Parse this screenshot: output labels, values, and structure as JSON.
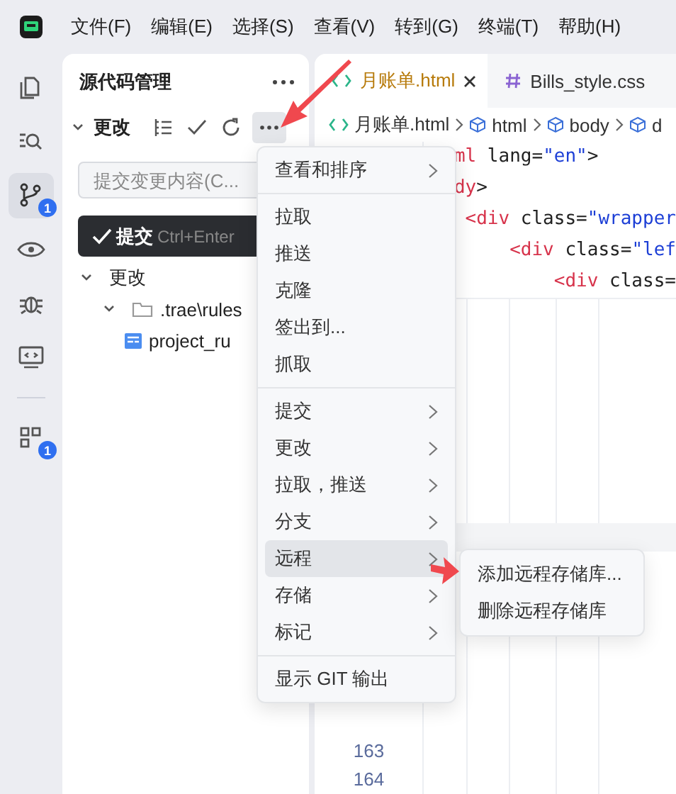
{
  "title_bar": {
    "menus": [
      "文件(F)",
      "编辑(E)",
      "选择(S)",
      "查看(V)",
      "转到(G)",
      "终端(T)",
      "帮助(H)"
    ]
  },
  "activity_bar": {
    "items": [
      {
        "kind": "files",
        "selected": false
      },
      {
        "kind": "search",
        "selected": false
      },
      {
        "kind": "git",
        "selected": true,
        "badge": "1"
      },
      {
        "kind": "eye",
        "selected": false
      },
      {
        "kind": "debug",
        "selected": false
      },
      {
        "kind": "remote",
        "selected": false
      },
      {
        "kind": "extensions",
        "selected": false,
        "badge": "1"
      }
    ]
  },
  "sidebar": {
    "title": "源代码管理",
    "section": {
      "label": "更改",
      "expanded": true
    },
    "commit_input": {
      "placeholder": "提交变更内容(C..."
    },
    "commit_button": {
      "label": "提交",
      "shortcut": "Ctrl+Enter"
    },
    "tree": [
      {
        "label": "更改",
        "expanded": true,
        "children": [
          {
            "label": ".trae\\rules",
            "kind": "folder",
            "expanded": true,
            "children": [
              {
                "label": "project_ru",
                "kind": "file"
              }
            ]
          }
        ]
      }
    ]
  },
  "editor": {
    "tabs": [
      {
        "label": "月账单.html",
        "kind": "html",
        "selected": true
      },
      {
        "label": "Bills_style.css",
        "kind": "css",
        "selected": false
      }
    ],
    "breadcrumb": [
      {
        "label": "月账单.html",
        "kind": "file"
      },
      {
        "label": "html",
        "kind": "element"
      },
      {
        "label": "body",
        "kind": "element"
      },
      {
        "label": "d",
        "kind": "element"
      }
    ],
    "code_lines": [
      [
        {
          "text": "ml",
          "kind": "tag"
        },
        {
          "text": " lang=",
          "kind": "attr"
        },
        {
          "text": "\"en\"",
          "kind": "string"
        },
        {
          "text": ">",
          "kind": "punct"
        }
      ],
      [
        {
          "text": "dy",
          "kind": "tag"
        },
        {
          "text": ">",
          "kind": "punct"
        }
      ],
      [
        {
          "text": " <div",
          "kind": "tag"
        },
        {
          "text": " class=",
          "kind": "attr"
        },
        {
          "text": "\"wrapper",
          "kind": "string"
        }
      ],
      [
        {
          "text": "     <div",
          "kind": "tag"
        },
        {
          "text": " class=",
          "kind": "attr"
        },
        {
          "text": "\"lef",
          "kind": "string"
        }
      ],
      [
        {
          "text": "         <div",
          "kind": "tag"
        },
        {
          "text": " class=",
          "kind": "attr"
        }
      ]
    ],
    "line_numbers": [
      "163",
      "164"
    ]
  },
  "context_menu": {
    "groups": [
      [
        {
          "label": "查看和排序",
          "submenu": true,
          "selected": false
        }
      ],
      [
        {
          "label": "拉取",
          "submenu": false,
          "selected": false
        },
        {
          "label": "推送",
          "submenu": false,
          "selected": false
        },
        {
          "label": "克隆",
          "submenu": false,
          "selected": false
        },
        {
          "label": "签出到...",
          "submenu": false,
          "selected": false
        },
        {
          "label": "抓取",
          "submenu": false,
          "selected": false
        }
      ],
      [
        {
          "label": "提交",
          "submenu": true,
          "selected": false
        },
        {
          "label": "更改",
          "submenu": true,
          "selected": false
        },
        {
          "label": "拉取，推送",
          "submenu": true,
          "selected": false
        },
        {
          "label": "分支",
          "submenu": true,
          "selected": false
        },
        {
          "label": "远程",
          "submenu": true,
          "selected": true
        },
        {
          "label": "存储",
          "submenu": true,
          "selected": false
        },
        {
          "label": "标记",
          "submenu": true,
          "selected": false
        }
      ],
      [
        {
          "label": "显示 GIT 输出",
          "submenu": false,
          "selected": false
        }
      ]
    ]
  },
  "submenu": {
    "items": [
      {
        "label": "添加远程存储库...",
        "selected": false
      },
      {
        "label": "删除远程存储库",
        "selected": false
      }
    ]
  }
}
